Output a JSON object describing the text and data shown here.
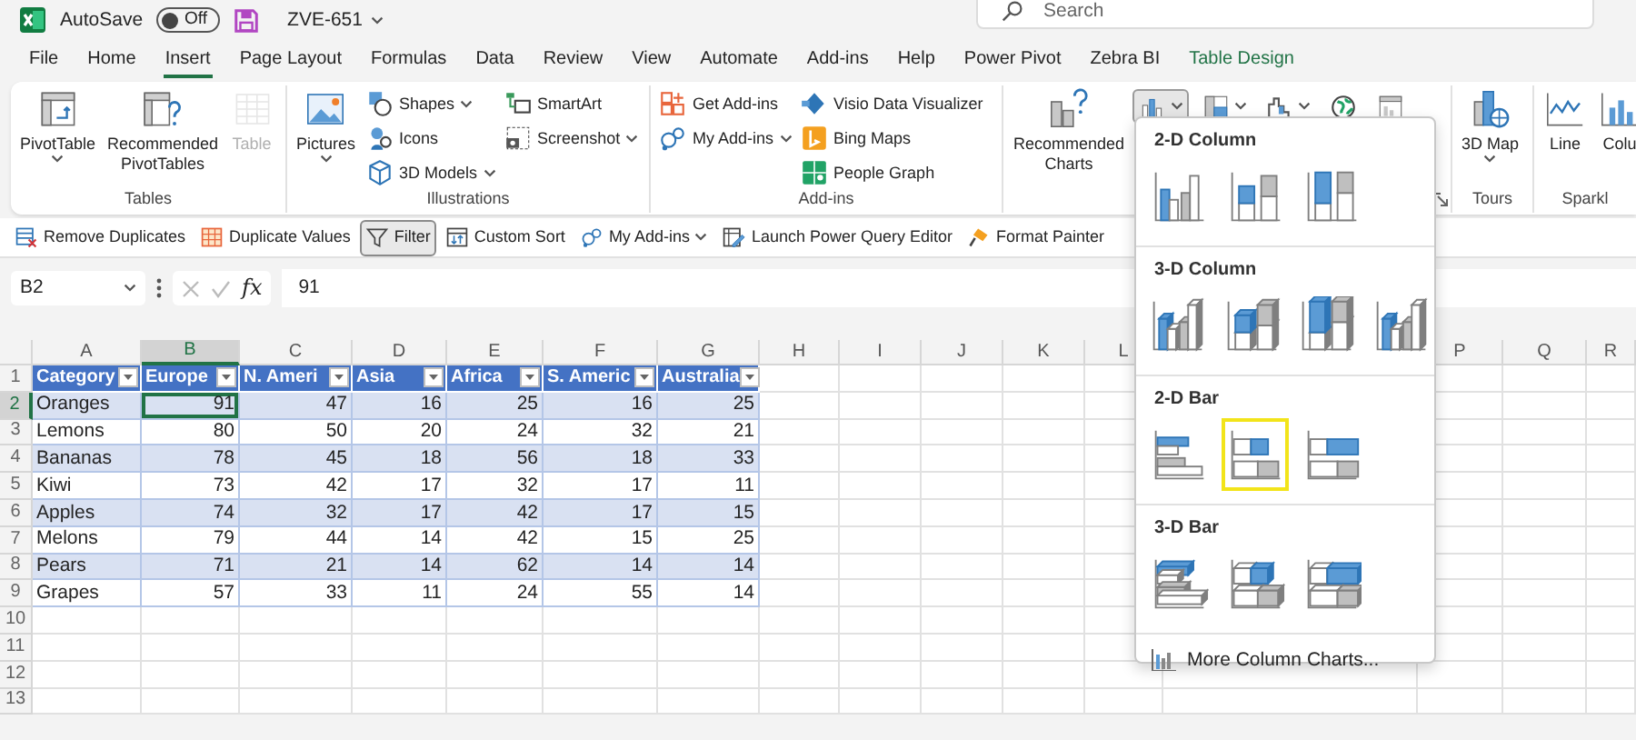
{
  "title_bar": {
    "autosave_label": "AutoSave",
    "autosave": {
      "on": false,
      "label": "Off"
    },
    "file_name": "ZVE-651",
    "search": {
      "placeholder": "Search"
    }
  },
  "tabs": [
    {
      "label": "File",
      "selected": false,
      "kind": "standard"
    },
    {
      "label": "Home",
      "selected": false,
      "kind": "standard"
    },
    {
      "label": "Insert",
      "selected": true,
      "kind": "standard"
    },
    {
      "label": "Page Layout",
      "selected": false,
      "kind": "standard"
    },
    {
      "label": "Formulas",
      "selected": false,
      "kind": "standard"
    },
    {
      "label": "Data",
      "selected": false,
      "kind": "standard"
    },
    {
      "label": "Review",
      "selected": false,
      "kind": "standard"
    },
    {
      "label": "View",
      "selected": false,
      "kind": "standard"
    },
    {
      "label": "Automate",
      "selected": false,
      "kind": "standard"
    },
    {
      "label": "Add-ins",
      "selected": false,
      "kind": "standard"
    },
    {
      "label": "Help",
      "selected": false,
      "kind": "standard"
    },
    {
      "label": "Power Pivot",
      "selected": false,
      "kind": "standard"
    },
    {
      "label": "Zebra BI",
      "selected": false,
      "kind": "standard"
    },
    {
      "label": "Table Design",
      "selected": false,
      "kind": "contextual"
    }
  ],
  "ribbon_groups": [
    {
      "label": "Tables",
      "launcher": false,
      "columns": [
        [
          {
            "label": "PivotTable",
            "kind": "large",
            "dropdown": true,
            "disabled": false
          }
        ],
        [
          {
            "label": "Recommended PivotTables",
            "kind": "large",
            "dropdown": false,
            "disabled": false
          }
        ],
        [
          {
            "label": "Table",
            "kind": "large",
            "dropdown": false,
            "disabled": true
          }
        ]
      ]
    },
    {
      "label": "Illustrations",
      "launcher": false,
      "columns": [
        [
          {
            "label": "Pictures",
            "kind": "large",
            "dropdown": true,
            "disabled": false
          }
        ],
        [
          {
            "label": "Shapes",
            "kind": "small",
            "dropdown": true,
            "disabled": false
          },
          {
            "label": "Icons",
            "kind": "small",
            "dropdown": false,
            "disabled": false
          },
          {
            "label": "3D Models",
            "kind": "small",
            "dropdown": true,
            "disabled": false
          }
        ],
        [
          {
            "label": "SmartArt",
            "kind": "small",
            "dropdown": false,
            "disabled": false
          },
          {
            "label": "Screenshot",
            "kind": "small",
            "dropdown": true,
            "disabled": false
          }
        ]
      ]
    },
    {
      "label": "Add-ins",
      "launcher": false,
      "columns": [
        [
          {
            "label": "Get Add-ins",
            "kind": "small",
            "dropdown": false,
            "disabled": false
          },
          {
            "label": "My Add-ins",
            "kind": "small",
            "dropdown": true,
            "disabled": false
          }
        ],
        [
          {
            "label": "Visio Data Visualizer",
            "kind": "small",
            "dropdown": false,
            "disabled": false
          },
          {
            "label": "Bing Maps",
            "kind": "small",
            "dropdown": false,
            "disabled": false
          },
          {
            "label": "People Graph",
            "kind": "small",
            "dropdown": false,
            "disabled": false
          }
        ]
      ]
    },
    {
      "launcher": true,
      "columns": [
        [
          {
            "label": "Recommended Charts",
            "kind": "large",
            "dropdown": false,
            "disabled": false
          }
        ],
        [
          {
            "kind": "icon_row",
            "buttons": [
              {
                "selected": true,
                "dropdown": true
              },
              {
                "selected": false,
                "dropdown": true
              },
              {
                "selected": false,
                "dropdown": true
              },
              {
                "selected": false,
                "dropdown": false
              },
              {
                "selected": false,
                "dropdown": false
              }
            ]
          }
        ]
      ]
    },
    {
      "label": "Tours",
      "launcher": false,
      "columns": [
        [
          {
            "label": "3D Map",
            "kind": "large",
            "dropdown": true,
            "disabled": false
          }
        ]
      ]
    },
    {
      "label": "Sparkl",
      "launcher": false,
      "columns": [
        [
          {
            "label": "Line",
            "kind": "large",
            "dropdown": false,
            "disabled": false
          }
        ],
        [
          {
            "label": "Colu",
            "kind": "large",
            "dropdown": false,
            "disabled": false
          }
        ]
      ]
    }
  ],
  "quick_toolbar": [
    {
      "label": "Remove Duplicates",
      "selected": false,
      "dropdown": false
    },
    {
      "label": "Duplicate Values",
      "selected": false,
      "dropdown": false
    },
    {
      "label": "Filter",
      "selected": true,
      "dropdown": false
    },
    {
      "label": "Custom Sort",
      "selected": false,
      "dropdown": false
    },
    {
      "label": "My Add-ins",
      "selected": false,
      "dropdown": true
    },
    {
      "label": "Launch Power Query Editor",
      "selected": false,
      "dropdown": false
    },
    {
      "label": "Format Painter",
      "selected": false,
      "dropdown": false
    }
  ],
  "formula_bar": {
    "name_box": "B2",
    "function_label": "fx",
    "formula": "91"
  },
  "sheet": {
    "columns": [
      {
        "letter": "A",
        "selected": false
      },
      {
        "letter": "B",
        "selected": true
      },
      {
        "letter": "C",
        "selected": false
      },
      {
        "letter": "D",
        "selected": false
      },
      {
        "letter": "E",
        "selected": false
      },
      {
        "letter": "F",
        "selected": false
      },
      {
        "letter": "G",
        "selected": false
      },
      {
        "letter": "H",
        "selected": false
      },
      {
        "letter": "I",
        "selected": false
      },
      {
        "letter": "J",
        "selected": false
      },
      {
        "letter": "K",
        "selected": false
      },
      {
        "letter": "L",
        "selected": false
      },
      {
        "letter": "P",
        "selected": false
      },
      {
        "letter": "Q",
        "selected": false
      },
      {
        "letter": "R",
        "selected": false
      }
    ],
    "rows": [
      {
        "number": "1",
        "selected": false
      },
      {
        "number": "2",
        "selected": true
      },
      {
        "number": "3",
        "selected": false
      },
      {
        "number": "4",
        "selected": false
      },
      {
        "number": "5",
        "selected": false
      },
      {
        "number": "6",
        "selected": false
      },
      {
        "number": "7",
        "selected": false
      },
      {
        "number": "8",
        "selected": false
      },
      {
        "number": "9",
        "selected": false
      },
      {
        "number": "10",
        "selected": false
      },
      {
        "number": "11",
        "selected": false
      },
      {
        "number": "12",
        "selected": false
      },
      {
        "number": "13",
        "selected": false
      }
    ]
  },
  "table": {
    "headers": [
      "Category",
      "Europe",
      "N. Ameri",
      "Asia",
      "Africa",
      "S. Americ",
      "Australia"
    ],
    "rows": [
      {
        "cells": [
          {
            "text": "Oranges",
            "selected": false
          },
          {
            "text": "91",
            "selected": true
          },
          {
            "text": "47",
            "selected": false
          },
          {
            "text": "16",
            "selected": false
          },
          {
            "text": "25",
            "selected": false
          },
          {
            "text": "16",
            "selected": false
          },
          {
            "text": "25",
            "selected": false
          }
        ]
      },
      {
        "cells": [
          {
            "text": "Lemons",
            "selected": false
          },
          {
            "text": "80",
            "selected": false
          },
          {
            "text": "50",
            "selected": false
          },
          {
            "text": "20",
            "selected": false
          },
          {
            "text": "24",
            "selected": false
          },
          {
            "text": "32",
            "selected": false
          },
          {
            "text": "21",
            "selected": false
          }
        ]
      },
      {
        "cells": [
          {
            "text": "Bananas",
            "selected": false
          },
          {
            "text": "78",
            "selected": false
          },
          {
            "text": "45",
            "selected": false
          },
          {
            "text": "18",
            "selected": false
          },
          {
            "text": "56",
            "selected": false
          },
          {
            "text": "18",
            "selected": false
          },
          {
            "text": "33",
            "selected": false
          }
        ]
      },
      {
        "cells": [
          {
            "text": "Kiwi",
            "selected": false
          },
          {
            "text": "73",
            "selected": false
          },
          {
            "text": "42",
            "selected": false
          },
          {
            "text": "17",
            "selected": false
          },
          {
            "text": "32",
            "selected": false
          },
          {
            "text": "17",
            "selected": false
          },
          {
            "text": "11",
            "selected": false
          }
        ]
      },
      {
        "cells": [
          {
            "text": "Apples",
            "selected": false
          },
          {
            "text": "74",
            "selected": false
          },
          {
            "text": "32",
            "selected": false
          },
          {
            "text": "17",
            "selected": false
          },
          {
            "text": "42",
            "selected": false
          },
          {
            "text": "17",
            "selected": false
          },
          {
            "text": "15",
            "selected": false
          }
        ]
      },
      {
        "cells": [
          {
            "text": "Melons",
            "selected": false
          },
          {
            "text": "79",
            "selected": false
          },
          {
            "text": "44",
            "selected": false
          },
          {
            "text": "14",
            "selected": false
          },
          {
            "text": "42",
            "selected": false
          },
          {
            "text": "15",
            "selected": false
          },
          {
            "text": "25",
            "selected": false
          }
        ]
      },
      {
        "cells": [
          {
            "text": "Pears",
            "selected": false
          },
          {
            "text": "71",
            "selected": false
          },
          {
            "text": "21",
            "selected": false
          },
          {
            "text": "14",
            "selected": false
          },
          {
            "text": "62",
            "selected": false
          },
          {
            "text": "14",
            "selected": false
          },
          {
            "text": "14",
            "selected": false
          }
        ]
      },
      {
        "cells": [
          {
            "text": "Grapes",
            "selected": false
          },
          {
            "text": "57",
            "selected": false
          },
          {
            "text": "33",
            "selected": false
          },
          {
            "text": "11",
            "selected": false
          },
          {
            "text": "24",
            "selected": false
          },
          {
            "text": "55",
            "selected": false
          },
          {
            "text": "14",
            "selected": false
          }
        ]
      }
    ]
  },
  "chart_menu": {
    "sections": [
      {
        "title": "2-D Column",
        "kind": "column",
        "items": [
          {
            "kind": "clustered",
            "selected": false
          },
          {
            "kind": "stacked",
            "selected": false
          },
          {
            "kind": "full",
            "selected": false
          }
        ]
      },
      {
        "title": "3-D Column",
        "kind": "column3d",
        "items": [
          {
            "kind": "clustered",
            "selected": false
          },
          {
            "kind": "stacked",
            "selected": false
          },
          {
            "kind": "full",
            "selected": false
          },
          {
            "kind": "depth",
            "selected": false
          }
        ]
      },
      {
        "title": "2-D Bar",
        "kind": "bar",
        "items": [
          {
            "kind": "clustered",
            "selected": false
          },
          {
            "kind": "stacked",
            "selected": true
          },
          {
            "kind": "full",
            "selected": false
          }
        ]
      },
      {
        "title": "3-D Bar",
        "kind": "bar3d",
        "items": [
          {
            "kind": "clustered",
            "selected": false
          },
          {
            "kind": "stacked",
            "selected": false
          },
          {
            "kind": "full",
            "selected": false
          }
        ]
      }
    ],
    "more_link": "More Column Charts..."
  }
}
